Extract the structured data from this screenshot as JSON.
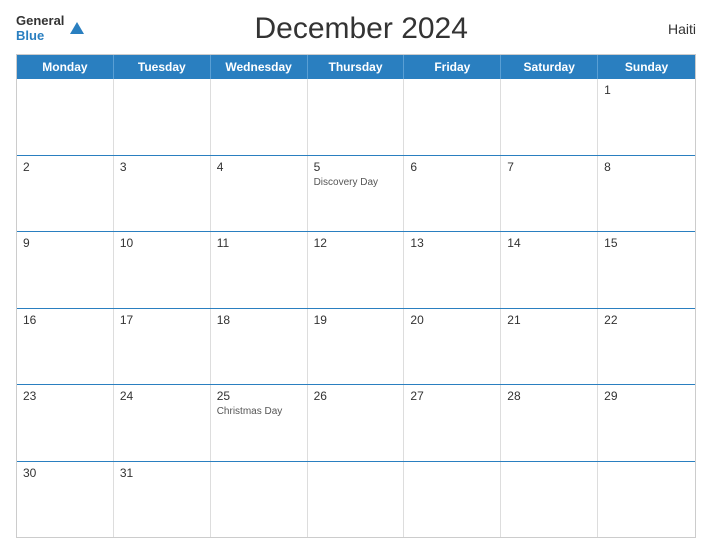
{
  "header": {
    "logo_general": "General",
    "logo_blue": "Blue",
    "title": "December 2024",
    "country": "Haiti"
  },
  "days": {
    "headers": [
      "Monday",
      "Tuesday",
      "Wednesday",
      "Thursday",
      "Friday",
      "Saturday",
      "Sunday"
    ]
  },
  "weeks": [
    [
      {
        "num": "",
        "event": ""
      },
      {
        "num": "",
        "event": ""
      },
      {
        "num": "",
        "event": ""
      },
      {
        "num": "",
        "event": ""
      },
      {
        "num": "",
        "event": ""
      },
      {
        "num": "",
        "event": ""
      },
      {
        "num": "1",
        "event": ""
      }
    ],
    [
      {
        "num": "2",
        "event": ""
      },
      {
        "num": "3",
        "event": ""
      },
      {
        "num": "4",
        "event": ""
      },
      {
        "num": "5",
        "event": "Discovery Day"
      },
      {
        "num": "6",
        "event": ""
      },
      {
        "num": "7",
        "event": ""
      },
      {
        "num": "8",
        "event": ""
      }
    ],
    [
      {
        "num": "9",
        "event": ""
      },
      {
        "num": "10",
        "event": ""
      },
      {
        "num": "11",
        "event": ""
      },
      {
        "num": "12",
        "event": ""
      },
      {
        "num": "13",
        "event": ""
      },
      {
        "num": "14",
        "event": ""
      },
      {
        "num": "15",
        "event": ""
      }
    ],
    [
      {
        "num": "16",
        "event": ""
      },
      {
        "num": "17",
        "event": ""
      },
      {
        "num": "18",
        "event": ""
      },
      {
        "num": "19",
        "event": ""
      },
      {
        "num": "20",
        "event": ""
      },
      {
        "num": "21",
        "event": ""
      },
      {
        "num": "22",
        "event": ""
      }
    ],
    [
      {
        "num": "23",
        "event": ""
      },
      {
        "num": "24",
        "event": ""
      },
      {
        "num": "25",
        "event": "Christmas Day"
      },
      {
        "num": "26",
        "event": ""
      },
      {
        "num": "27",
        "event": ""
      },
      {
        "num": "28",
        "event": ""
      },
      {
        "num": "29",
        "event": ""
      }
    ],
    [
      {
        "num": "30",
        "event": ""
      },
      {
        "num": "31",
        "event": ""
      },
      {
        "num": "",
        "event": ""
      },
      {
        "num": "",
        "event": ""
      },
      {
        "num": "",
        "event": ""
      },
      {
        "num": "",
        "event": ""
      },
      {
        "num": "",
        "event": ""
      }
    ]
  ]
}
